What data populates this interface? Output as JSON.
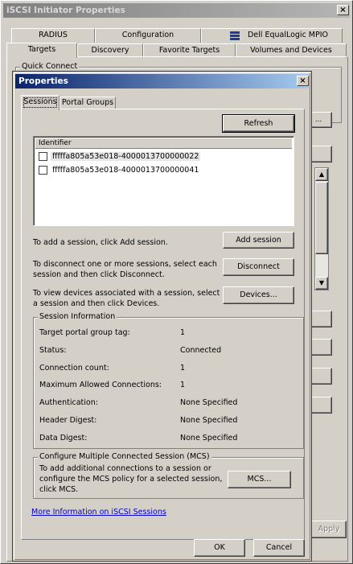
{
  "back_window": {
    "title": "iSCSI Initiator Properties",
    "close_glyph": "×",
    "tabs_row1": [
      "RADIUS",
      "Configuration",
      "Dell EqualLogic MPIO"
    ],
    "tabs_row2": [
      "Targets",
      "Discovery",
      "Favorite Targets",
      "Volumes and Devices"
    ],
    "quick_connect_label": "Quick Connect",
    "apply_label": "Apply"
  },
  "dialog": {
    "title": "Properties",
    "close_glyph": "×",
    "tabs": [
      "Sessions",
      "Portal Groups"
    ],
    "refresh_label": "Refresh",
    "list": {
      "header": "Identifier",
      "rows": [
        "fffffa805a53e018-4000013700000022",
        "fffffa805a53e018-4000013700000041"
      ]
    },
    "add_text": "To add a session, click Add session.",
    "add_label": "Add session",
    "disconnect_text_1": "To disconnect one or more sessions, select each",
    "disconnect_text_2": "session and then click Disconnect.",
    "disconnect_label": "Disconnect",
    "devices_text_1": "To view devices associated with a session, select",
    "devices_text_2": "a session and then click Devices.",
    "devices_label": "Devices...",
    "session_info": {
      "label": "Session Information",
      "rows": [
        {
          "key": "Target portal group tag:",
          "value": "1"
        },
        {
          "key": "Status:",
          "value": "Connected"
        },
        {
          "key": "Connection count:",
          "value": "1"
        },
        {
          "key": "Maximum Allowed Connections:",
          "value": "1"
        },
        {
          "key": "Authentication:",
          "value": "None Specified"
        },
        {
          "key": "Header Digest:",
          "value": "None Specified"
        },
        {
          "key": "Data Digest:",
          "value": "None Specified"
        }
      ]
    },
    "mcs": {
      "label": "Configure Multiple Connected Session (MCS)",
      "text_1": "To add additional connections to a session or",
      "text_2": "configure the MCS policy for a selected session,",
      "text_3": "click MCS.",
      "button_label": "MCS..."
    },
    "more_info_link": "More Information on iSCSI Sessions",
    "ok_label": "OK",
    "cancel_label": "Cancel"
  }
}
